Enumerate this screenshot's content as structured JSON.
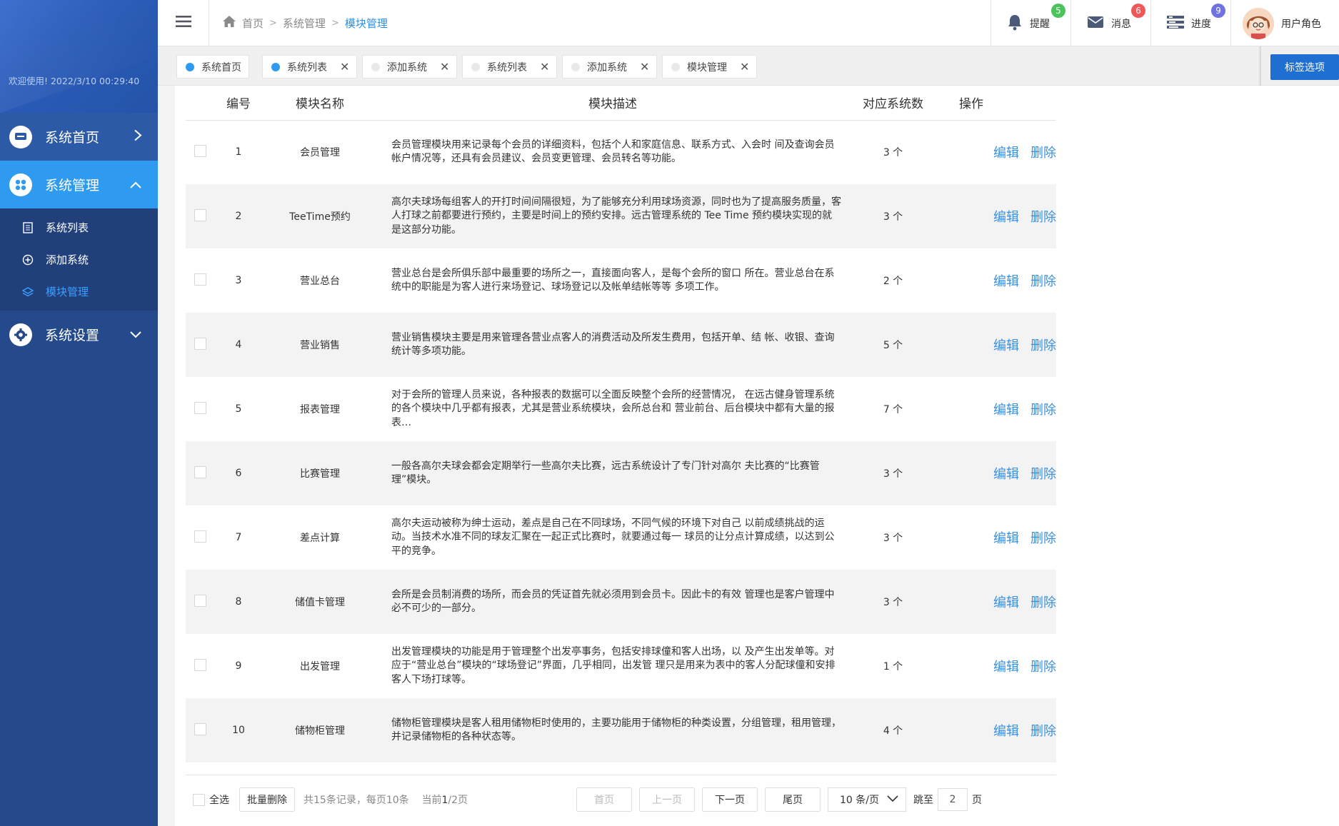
{
  "sidebar": {
    "welcome": "欢迎使用!  2022/3/10 00:29:40",
    "nav": {
      "home_label": "系统首页",
      "manage_label": "系统管理",
      "settings_label": "系统设置"
    },
    "submenu": [
      {
        "label": "系统列表",
        "icon": "document-icon"
      },
      {
        "label": "添加系统",
        "icon": "plus-circle-icon"
      },
      {
        "label": "模块管理",
        "icon": "layers-icon"
      }
    ]
  },
  "header": {
    "breadcrumb": {
      "home": "首页",
      "section": "系统管理",
      "current": "模块管理"
    },
    "tools": {
      "reminder": {
        "label": "提醒",
        "count": "5",
        "color": "#4cc35b"
      },
      "message": {
        "label": "消息",
        "count": "6",
        "color": "#f25757"
      },
      "progress": {
        "label": "进度",
        "count": "9",
        "color": "#6f72e0"
      },
      "user": {
        "label": "用户角色"
      }
    }
  },
  "tabs": {
    "items": [
      {
        "label": "系统首页",
        "active_dot": true,
        "closable": false
      },
      {
        "label": "系统列表",
        "active_dot": true,
        "closable": true
      },
      {
        "label": "添加系统",
        "active_dot": false,
        "closable": true
      },
      {
        "label": "系统列表",
        "active_dot": false,
        "closable": true
      },
      {
        "label": "添加系统",
        "active_dot": false,
        "closable": true
      },
      {
        "label": "模块管理",
        "active_dot": false,
        "closable": true
      }
    ],
    "options_label": "标签选项",
    "close_glyph": "✕"
  },
  "table": {
    "headers": {
      "num": "编号",
      "name": "模块名称",
      "desc": "模块描述",
      "count": "对应系统数",
      "ops": "操作"
    },
    "edit_label": "编辑",
    "delete_label": "删除",
    "rows": [
      {
        "num": "1",
        "name": "会员管理",
        "desc": "会员管理模块用来记录每个会员的详细资料，包括个人和家庭信息、联系方式、入会时 间及查询会员帐户情况等，还具有会员建议、会员变更管理、会员转名等功能。",
        "count": "3 个"
      },
      {
        "num": "2",
        "name": "TeeTime预约",
        "desc": "高尔夫球场每组客人的开打时间间隔很短，为了能够充分利用球场资源，同时也为了提高服务质量，客人打球之前都要进行预约，主要是时间上的预约安排。远古管理系统的 Tee Time 预约模块实现的就是这部分功能。",
        "count": "3 个"
      },
      {
        "num": "3",
        "name": "营业总台",
        "desc": "营业总台是会所俱乐部中最重要的场所之一，直接面向客人，是每个会所的窗口 所在。营业总台在系统中的职能是为客人进行来场登记、球场登记以及帐单结帐等等 多项工作。",
        "count": "2 个"
      },
      {
        "num": "4",
        "name": "营业销售",
        "desc": "营业销售模块主要是用来管理各营业点客人的消费活动及所发生费用，包括开单、结 帐、收银、查询统计等多项功能。",
        "count": "5 个"
      },
      {
        "num": "5",
        "name": "报表管理",
        "desc": "对于会所的管理人员来说，各种报表的数据可以全面反映整个会所的经营情况， 在远古健身管理系统的各个模块中几乎都有报表，尤其是营业系统模块，会所总台和 营业前台、后台模块中都有大量的报表…",
        "count": "7 个"
      },
      {
        "num": "6",
        "name": "比赛管理",
        "desc": "一般各高尔夫球会都会定期举行一些高尔夫比赛，远古系统设计了专门针对高尔 夫比赛的“比赛管理”模块。",
        "count": "3 个"
      },
      {
        "num": "7",
        "name": "差点计算",
        "desc": "高尔夫运动被称为绅士运动，差点是自己在不同球场，不同气候的环境下对自己 以前成绩挑战的运动。当技术水准不同的球友汇聚在一起正式比赛时，就要通过每一 球员的让分点计算成绩，以达到公平的竞争。",
        "count": "3 个"
      },
      {
        "num": "8",
        "name": "储值卡管理",
        "desc": "会所是会员制消费的场所，而会员的凭证首先就必须用到会员卡。因此卡的有效 管理也是客户管理中必不可少的一部分。",
        "count": "3 个"
      },
      {
        "num": "9",
        "name": "出发管理",
        "desc": "出发管理模块的功能是用于管理整个出发亭事务，包括安排球僮和客人出场，以 及产生出发单等。对应于“营业总台”模块的“球场登记”界面，几乎相同，出发管 理只是用来为表中的客人分配球僮和安排客人下场打球等。",
        "count": "1 个"
      },
      {
        "num": "10",
        "name": "储物柜管理",
        "desc": "储物柜管理模块是客人租用储物柜时使用的，主要功能用于储物柜的种类设置，分组管理，租用管理，并记录储物柜的各种状态等。",
        "count": "4 个"
      }
    ]
  },
  "footer": {
    "select_all": "全选",
    "batch_delete": "批量删除",
    "summary_prefix": "共15条记录，每页10条",
    "current_prefix": "当前",
    "current_page": "1",
    "total_pages": "/2页",
    "first": "首页",
    "prev": "上一页",
    "next": "下一页",
    "last": "尾页",
    "page_size": "10 条/页",
    "jump_label": "跳至",
    "jump_value": "2",
    "page_unit": "页"
  }
}
